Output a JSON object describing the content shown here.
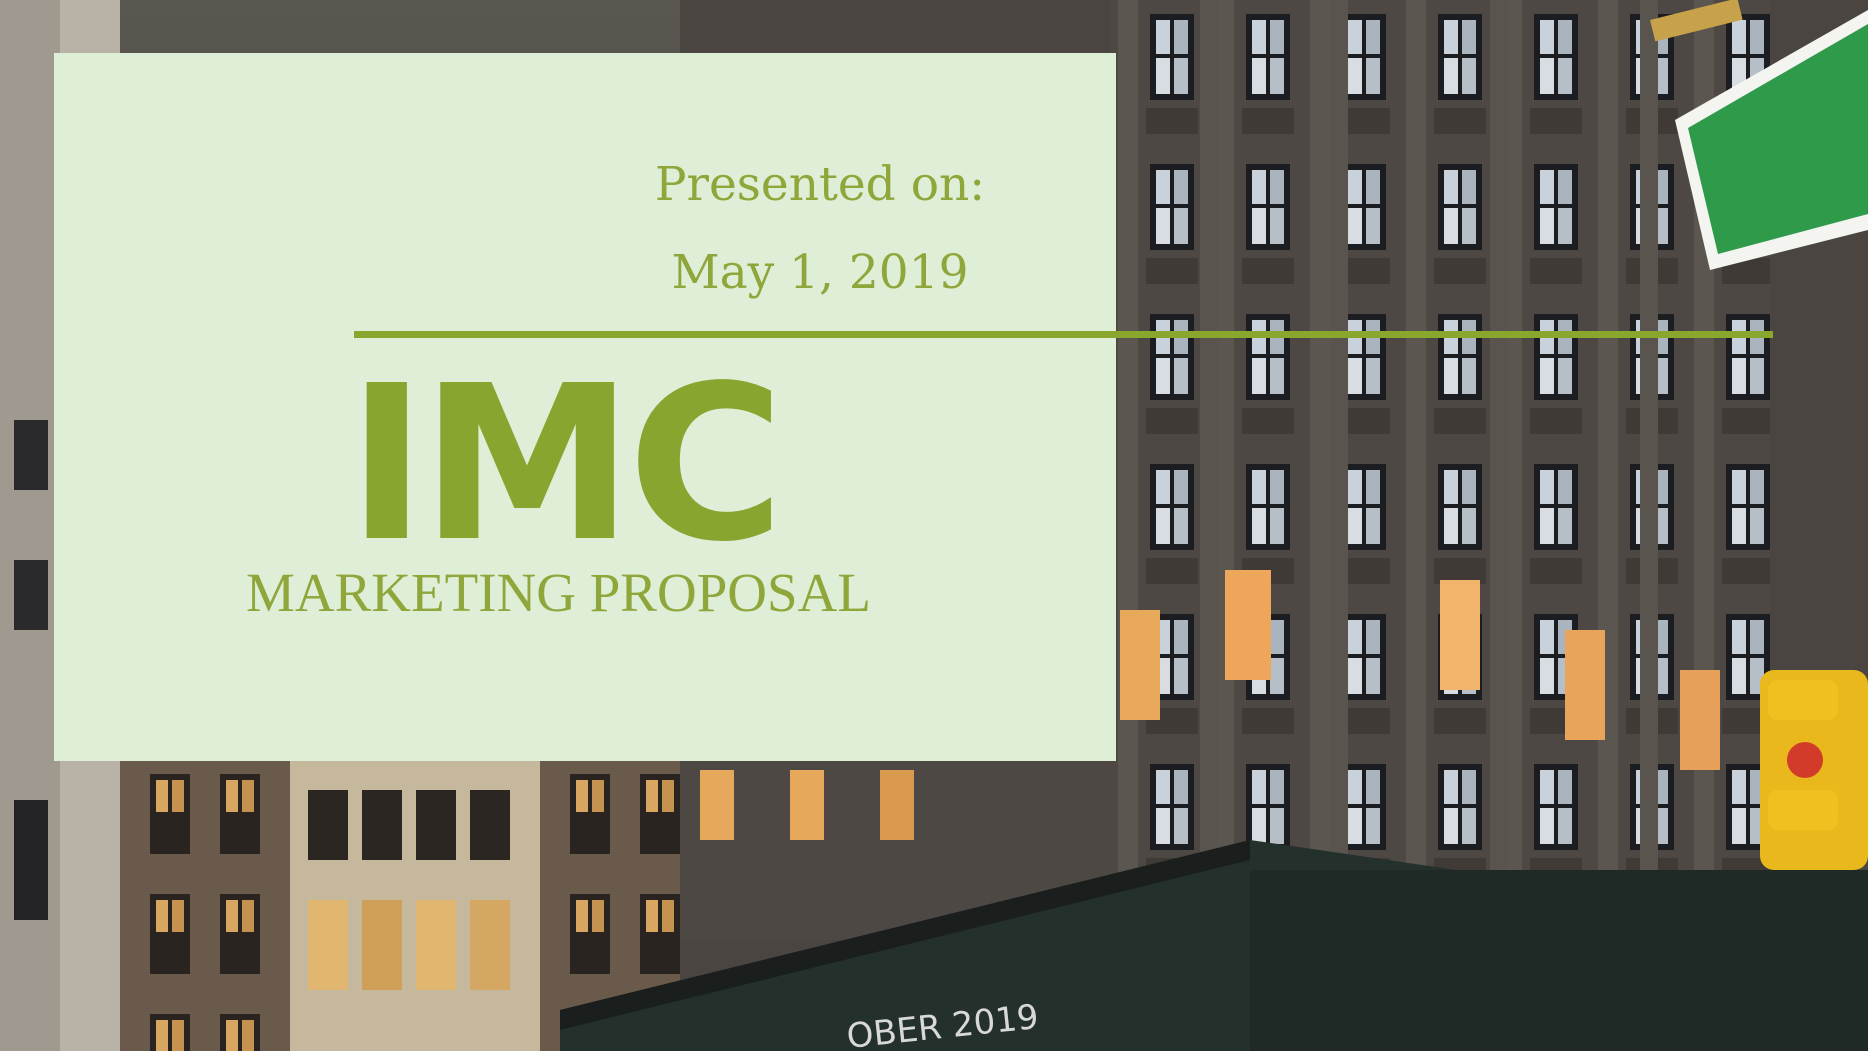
{
  "slide": {
    "presented_label": "Presented on:",
    "presented_date": "May 1, 2019",
    "company": "IMC",
    "subtitle": "MARKETING PROPOSAL"
  },
  "background_photo": {
    "banner_text": "OBER 2019"
  },
  "colors": {
    "card_background": "#dfeed6",
    "accent_green": "#88a530",
    "building_stone": "#4a4541",
    "construction_wall": "#1f2a26",
    "street_sign": "#2f9a4a",
    "traffic_light": "#f0c020"
  }
}
